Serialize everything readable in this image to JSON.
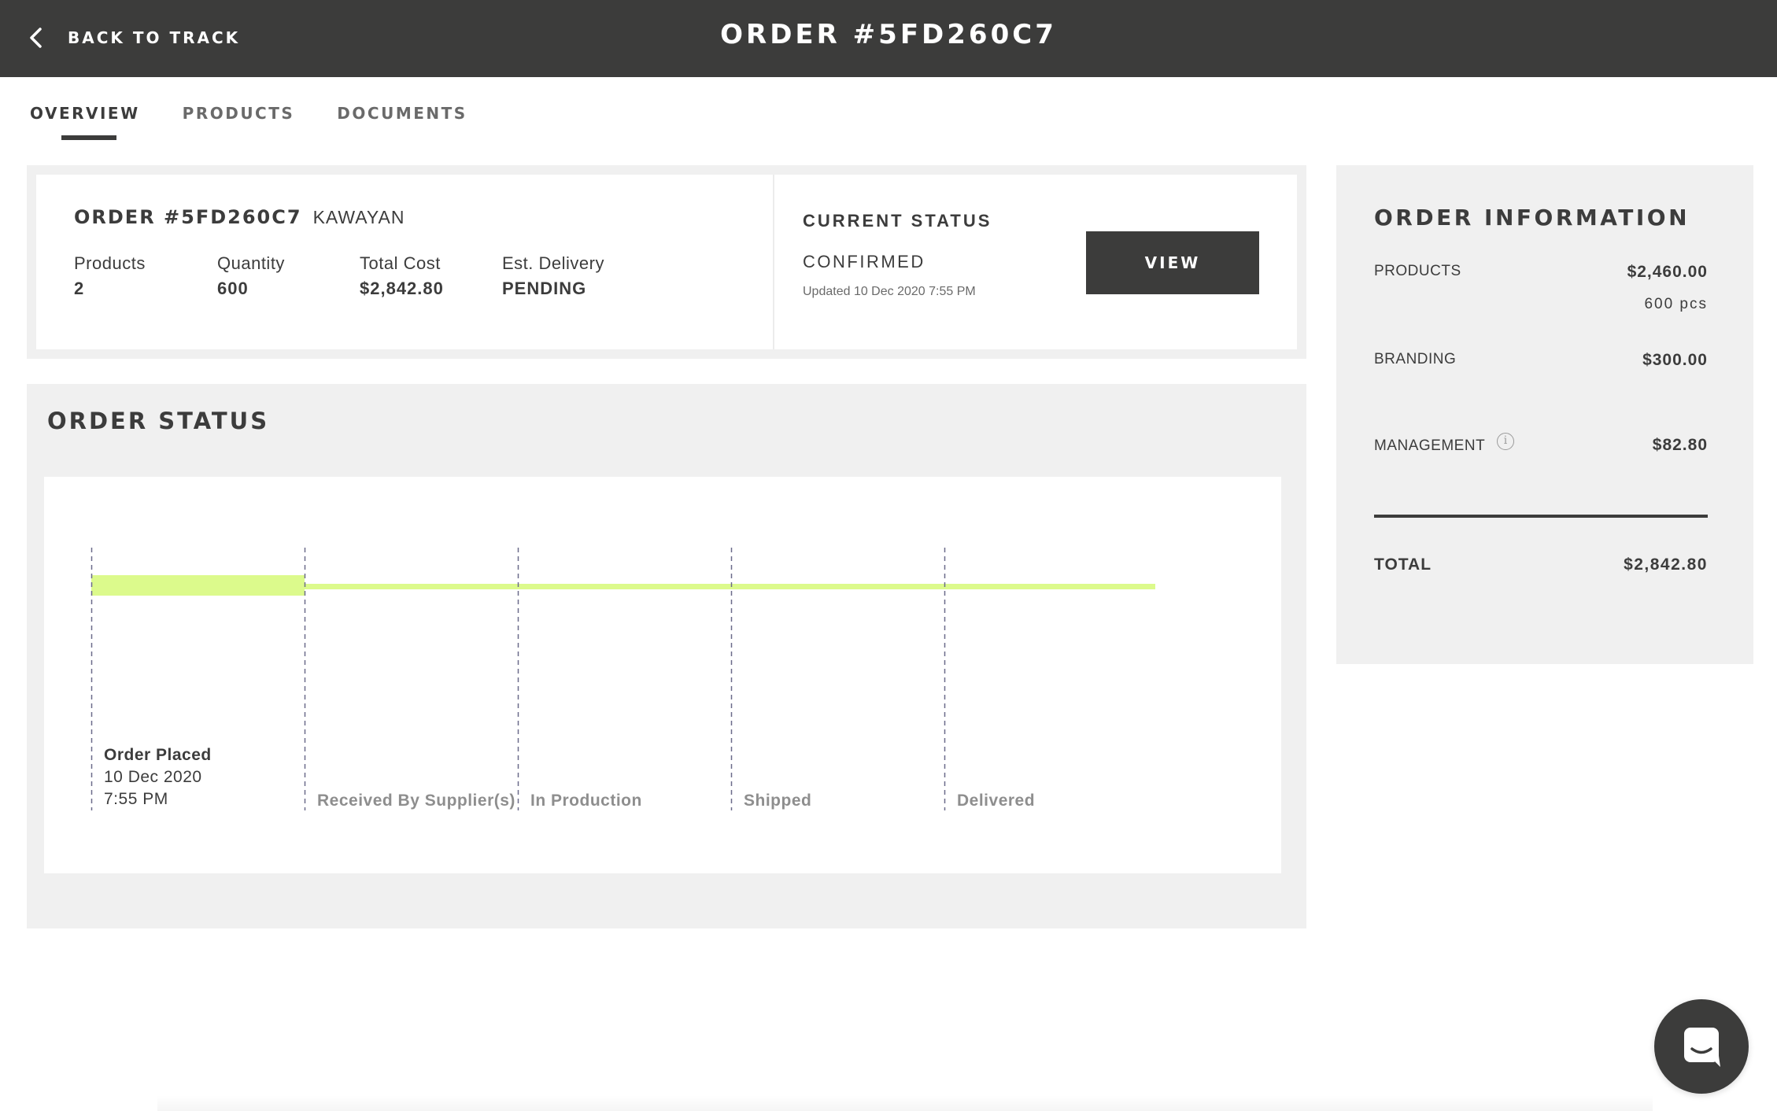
{
  "header": {
    "back_label": "BACK TO TRACK",
    "title": "ORDER #5FD260C7"
  },
  "tabs": [
    {
      "label": "OVERVIEW",
      "active": true
    },
    {
      "label": "PRODUCTS",
      "active": false
    },
    {
      "label": "DOCUMENTS",
      "active": false
    }
  ],
  "summary": {
    "order_number": "ORDER #5FD260C7",
    "supplier": "KAWAYAN",
    "products_label": "Products",
    "products_value": "2",
    "quantity_label": "Quantity",
    "quantity_value": "600",
    "total_cost_label": "Total Cost",
    "total_cost_value": "$2,842.80",
    "delivery_label": "Est. Delivery",
    "delivery_value": "PENDING",
    "status_title": "CURRENT STATUS",
    "status_value": "CONFIRMED",
    "status_updated": "Updated 10 Dec 2020 7:55 PM",
    "view_label": "VIEW"
  },
  "order_status": {
    "heading": "ORDER STATUS",
    "progress_stage_index": 0,
    "accent_color": "#dcfa8c",
    "stages": [
      {
        "label": "Order Placed",
        "date": "10 Dec 2020",
        "time": "7:55 PM",
        "done": true
      },
      {
        "label": "Received By Supplier(s)",
        "done": false
      },
      {
        "label": "In Production",
        "done": false
      },
      {
        "label": "Shipped",
        "done": false
      },
      {
        "label": "Delivered",
        "done": false
      }
    ]
  },
  "order_info": {
    "heading": "ORDER INFORMATION",
    "products_label": "PRODUCTS",
    "products_value": "$2,460.00",
    "products_qty": "600 pcs",
    "branding_label": "BRANDING",
    "branding_value": "$300.00",
    "management_label": "MANAGEMENT",
    "management_value": "$82.80",
    "total_label": "TOTAL",
    "total_value": "$2,842.80"
  },
  "colors": {
    "header_bg": "#3c3c3b",
    "panel_bg": "#f0f0f0",
    "progress": "#dcfa8c"
  },
  "icons": {
    "back": "chevron-left-icon",
    "info": "info-icon",
    "chat": "chat-icon"
  }
}
